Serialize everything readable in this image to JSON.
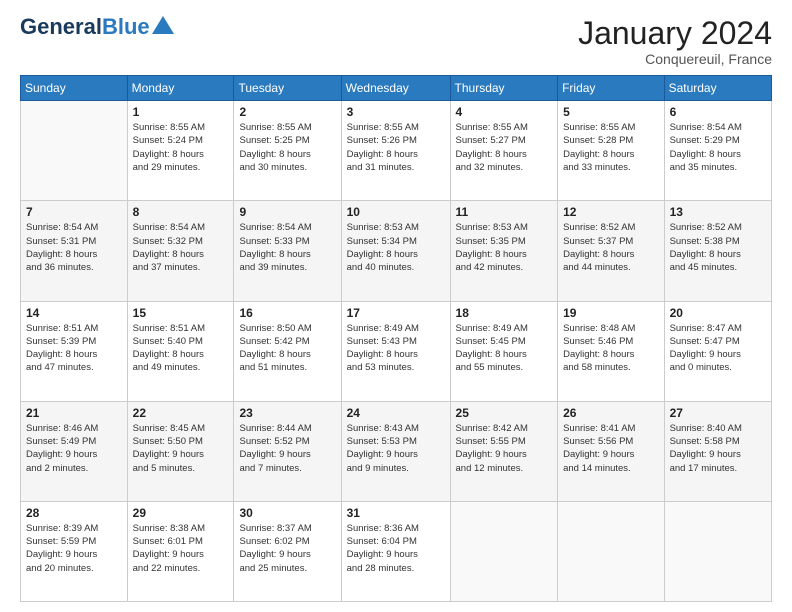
{
  "logo": {
    "line1": "General",
    "line2": "Blue"
  },
  "title": "January 2024",
  "subtitle": "Conquereuil, France",
  "days_header": [
    "Sunday",
    "Monday",
    "Tuesday",
    "Wednesday",
    "Thursday",
    "Friday",
    "Saturday"
  ],
  "weeks": [
    [
      {
        "num": "",
        "info": ""
      },
      {
        "num": "1",
        "info": "Sunrise: 8:55 AM\nSunset: 5:24 PM\nDaylight: 8 hours\nand 29 minutes."
      },
      {
        "num": "2",
        "info": "Sunrise: 8:55 AM\nSunset: 5:25 PM\nDaylight: 8 hours\nand 30 minutes."
      },
      {
        "num": "3",
        "info": "Sunrise: 8:55 AM\nSunset: 5:26 PM\nDaylight: 8 hours\nand 31 minutes."
      },
      {
        "num": "4",
        "info": "Sunrise: 8:55 AM\nSunset: 5:27 PM\nDaylight: 8 hours\nand 32 minutes."
      },
      {
        "num": "5",
        "info": "Sunrise: 8:55 AM\nSunset: 5:28 PM\nDaylight: 8 hours\nand 33 minutes."
      },
      {
        "num": "6",
        "info": "Sunrise: 8:54 AM\nSunset: 5:29 PM\nDaylight: 8 hours\nand 35 minutes."
      }
    ],
    [
      {
        "num": "7",
        "info": "Sunrise: 8:54 AM\nSunset: 5:31 PM\nDaylight: 8 hours\nand 36 minutes."
      },
      {
        "num": "8",
        "info": "Sunrise: 8:54 AM\nSunset: 5:32 PM\nDaylight: 8 hours\nand 37 minutes."
      },
      {
        "num": "9",
        "info": "Sunrise: 8:54 AM\nSunset: 5:33 PM\nDaylight: 8 hours\nand 39 minutes."
      },
      {
        "num": "10",
        "info": "Sunrise: 8:53 AM\nSunset: 5:34 PM\nDaylight: 8 hours\nand 40 minutes."
      },
      {
        "num": "11",
        "info": "Sunrise: 8:53 AM\nSunset: 5:35 PM\nDaylight: 8 hours\nand 42 minutes."
      },
      {
        "num": "12",
        "info": "Sunrise: 8:52 AM\nSunset: 5:37 PM\nDaylight: 8 hours\nand 44 minutes."
      },
      {
        "num": "13",
        "info": "Sunrise: 8:52 AM\nSunset: 5:38 PM\nDaylight: 8 hours\nand 45 minutes."
      }
    ],
    [
      {
        "num": "14",
        "info": "Sunrise: 8:51 AM\nSunset: 5:39 PM\nDaylight: 8 hours\nand 47 minutes."
      },
      {
        "num": "15",
        "info": "Sunrise: 8:51 AM\nSunset: 5:40 PM\nDaylight: 8 hours\nand 49 minutes."
      },
      {
        "num": "16",
        "info": "Sunrise: 8:50 AM\nSunset: 5:42 PM\nDaylight: 8 hours\nand 51 minutes."
      },
      {
        "num": "17",
        "info": "Sunrise: 8:49 AM\nSunset: 5:43 PM\nDaylight: 8 hours\nand 53 minutes."
      },
      {
        "num": "18",
        "info": "Sunrise: 8:49 AM\nSunset: 5:45 PM\nDaylight: 8 hours\nand 55 minutes."
      },
      {
        "num": "19",
        "info": "Sunrise: 8:48 AM\nSunset: 5:46 PM\nDaylight: 8 hours\nand 58 minutes."
      },
      {
        "num": "20",
        "info": "Sunrise: 8:47 AM\nSunset: 5:47 PM\nDaylight: 9 hours\nand 0 minutes."
      }
    ],
    [
      {
        "num": "21",
        "info": "Sunrise: 8:46 AM\nSunset: 5:49 PM\nDaylight: 9 hours\nand 2 minutes."
      },
      {
        "num": "22",
        "info": "Sunrise: 8:45 AM\nSunset: 5:50 PM\nDaylight: 9 hours\nand 5 minutes."
      },
      {
        "num": "23",
        "info": "Sunrise: 8:44 AM\nSunset: 5:52 PM\nDaylight: 9 hours\nand 7 minutes."
      },
      {
        "num": "24",
        "info": "Sunrise: 8:43 AM\nSunset: 5:53 PM\nDaylight: 9 hours\nand 9 minutes."
      },
      {
        "num": "25",
        "info": "Sunrise: 8:42 AM\nSunset: 5:55 PM\nDaylight: 9 hours\nand 12 minutes."
      },
      {
        "num": "26",
        "info": "Sunrise: 8:41 AM\nSunset: 5:56 PM\nDaylight: 9 hours\nand 14 minutes."
      },
      {
        "num": "27",
        "info": "Sunrise: 8:40 AM\nSunset: 5:58 PM\nDaylight: 9 hours\nand 17 minutes."
      }
    ],
    [
      {
        "num": "28",
        "info": "Sunrise: 8:39 AM\nSunset: 5:59 PM\nDaylight: 9 hours\nand 20 minutes."
      },
      {
        "num": "29",
        "info": "Sunrise: 8:38 AM\nSunset: 6:01 PM\nDaylight: 9 hours\nand 22 minutes."
      },
      {
        "num": "30",
        "info": "Sunrise: 8:37 AM\nSunset: 6:02 PM\nDaylight: 9 hours\nand 25 minutes."
      },
      {
        "num": "31",
        "info": "Sunrise: 8:36 AM\nSunset: 6:04 PM\nDaylight: 9 hours\nand 28 minutes."
      },
      {
        "num": "",
        "info": ""
      },
      {
        "num": "",
        "info": ""
      },
      {
        "num": "",
        "info": ""
      }
    ]
  ]
}
